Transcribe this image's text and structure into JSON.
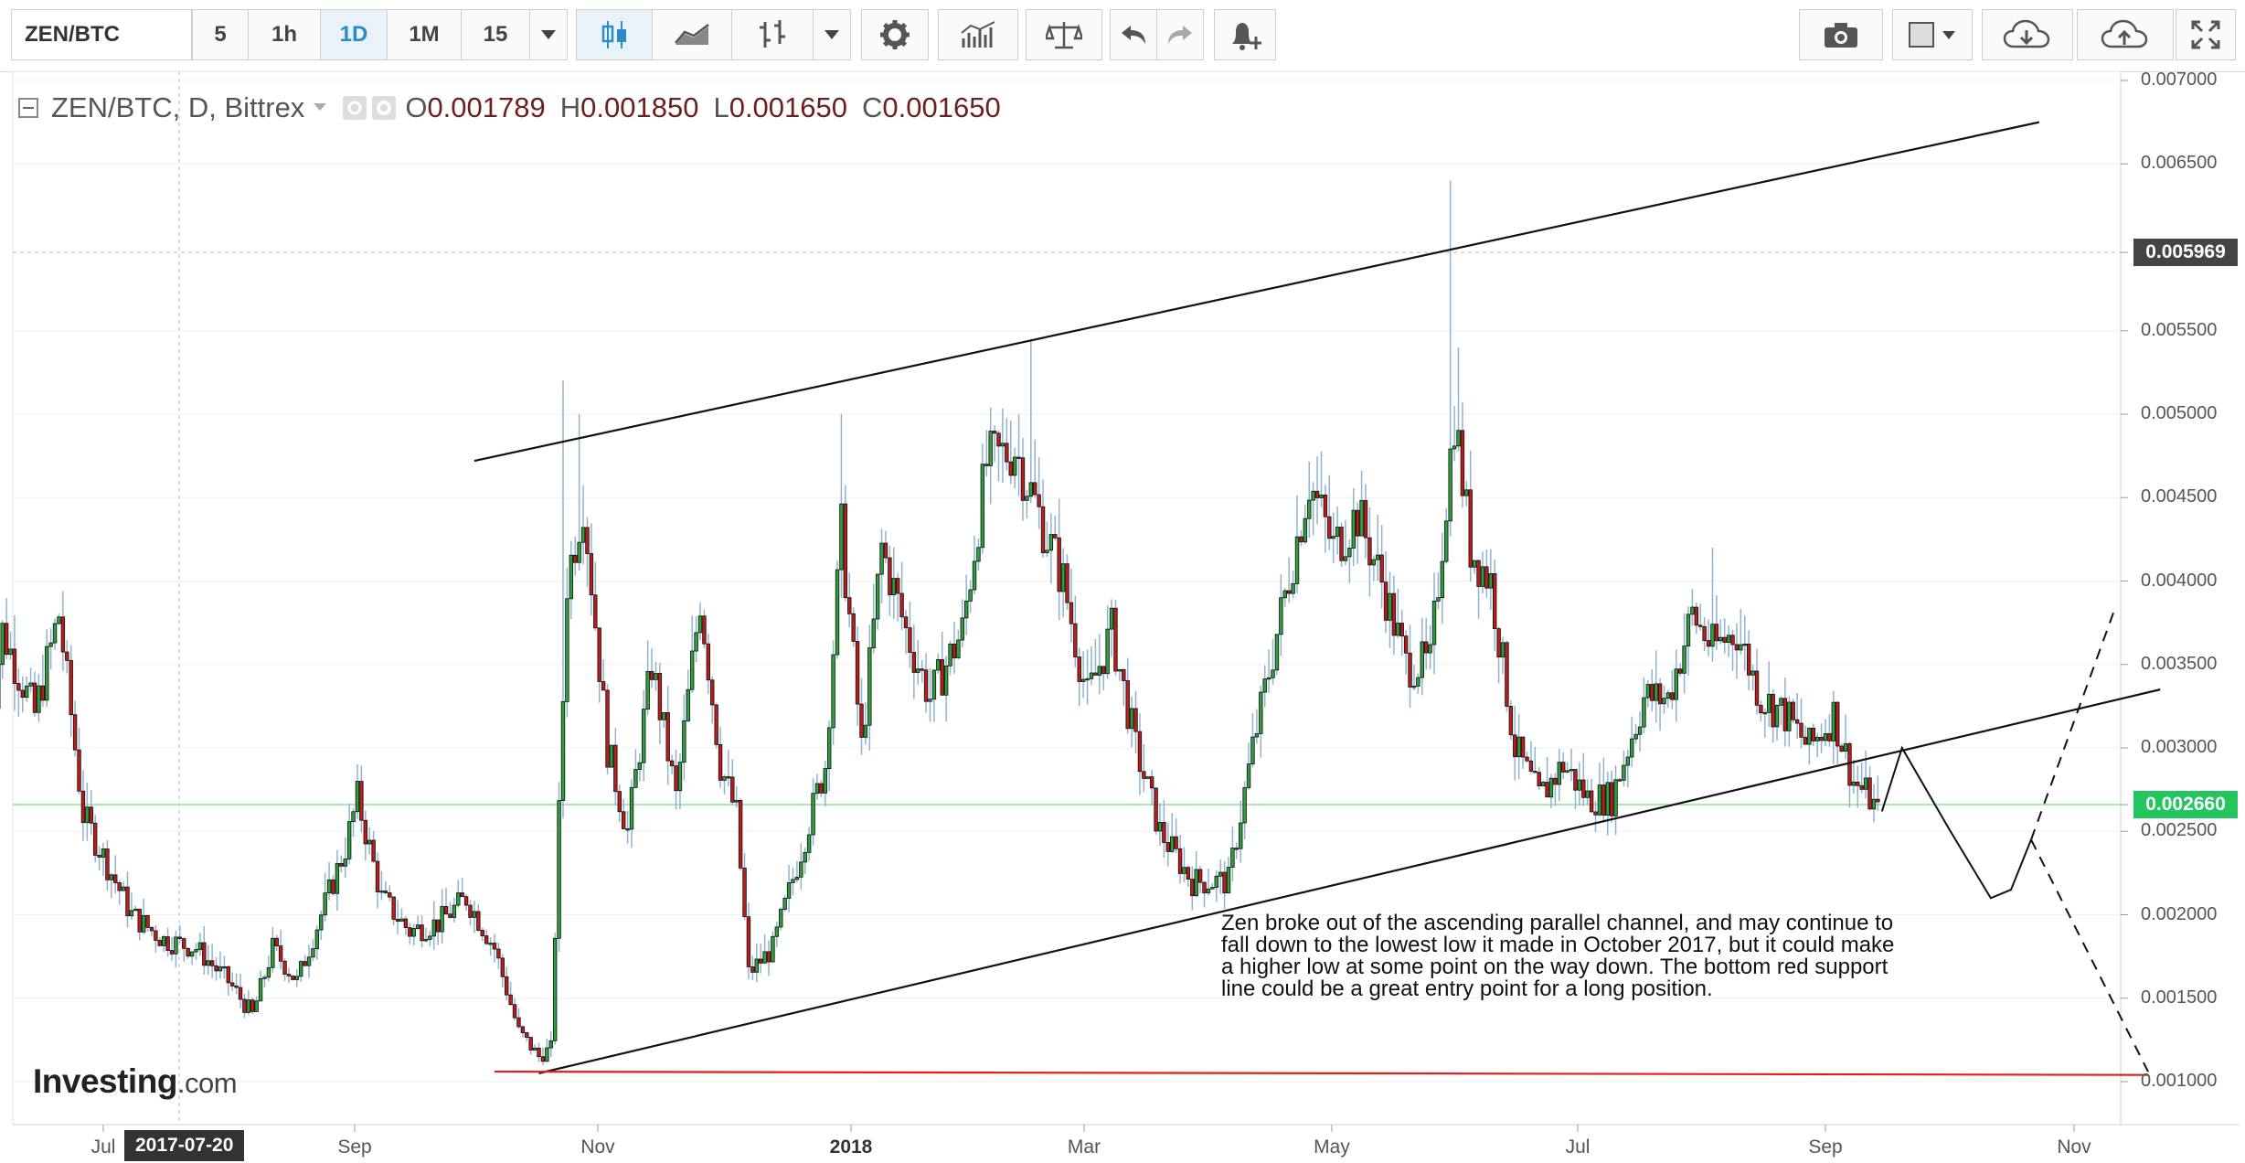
{
  "toolbar": {
    "symbol": "ZEN/BTC",
    "intervals": [
      "5",
      "1h",
      "1D",
      "1M",
      "15"
    ],
    "active_interval": "1D"
  },
  "legend": {
    "title": "ZEN/BTC, D, Bittrex",
    "open_label": "O",
    "open": "0.001789",
    "high_label": "H",
    "high": "0.001850",
    "low_label": "L",
    "low": "0.001650",
    "close_label": "C",
    "close": "0.001650"
  },
  "price_axis": {
    "ticks": [
      "0.007000",
      "0.006500",
      "0.005969",
      "0.005500",
      "0.005000",
      "0.004500",
      "0.004000",
      "0.003500",
      "0.003000",
      "0.002660",
      "0.002500",
      "0.002000",
      "0.001500",
      "0.001000"
    ],
    "current_price": "0.002660",
    "current_price_color": "#22c55e",
    "crosshair_price": "0.005969",
    "crosshair_color": "#444444"
  },
  "time_axis": {
    "labels": [
      "Jul",
      "2017-07-20",
      "Sep",
      "Nov",
      "2018",
      "Mar",
      "May",
      "Jul",
      "Sep",
      "Nov"
    ]
  },
  "annotation": "Zen broke out of the ascending parallel channel, and may continue to fall down to the lowest low it made in October 2017, but it could make a higher low at some point on the way down. The bottom red support line could be a great entry point for a long position.",
  "logo": {
    "brand": "Investing",
    "suffix": ".com"
  },
  "colors": {
    "up": "#2e9e3e",
    "down": "#b91d1d",
    "support": "#e11d1d",
    "channel": "#111111"
  },
  "chart_data": {
    "type": "candlestick",
    "title": "ZEN/BTC, D, Bittrex",
    "ylim": [
      0.00082,
      0.007
    ],
    "x_range": [
      "2017-06-01",
      "2018-11-20"
    ],
    "ohlc_last": {
      "open": 0.001789,
      "high": 0.00185,
      "low": 0.00165,
      "close": 0.00165
    },
    "close_path": [
      [
        "2017-06-02",
        0.003
      ],
      [
        "2017-06-06",
        0.0037
      ],
      [
        "2017-06-14",
        0.0032
      ],
      [
        "2017-06-20",
        0.0038
      ],
      [
        "2017-06-26",
        0.0026
      ],
      [
        "2017-07-02",
        0.0023
      ],
      [
        "2017-07-08",
        0.002
      ],
      [
        "2017-07-16",
        0.00185
      ],
      [
        "2017-07-24",
        0.0018
      ],
      [
        "2017-08-01",
        0.0016
      ],
      [
        "2017-08-07",
        0.0014
      ],
      [
        "2017-08-12",
        0.0018
      ],
      [
        "2017-08-18",
        0.0016
      ],
      [
        "2017-08-24",
        0.002
      ],
      [
        "2017-08-30",
        0.0024
      ],
      [
        "2017-09-02",
        0.0027
      ],
      [
        "2017-09-08",
        0.0021
      ],
      [
        "2017-09-15",
        0.0019
      ],
      [
        "2017-09-22",
        0.00195
      ],
      [
        "2017-09-29",
        0.0021
      ],
      [
        "2017-10-06",
        0.0018
      ],
      [
        "2017-10-12",
        0.0013
      ],
      [
        "2017-10-17",
        0.00115
      ],
      [
        "2017-10-20",
        0.0012
      ],
      [
        "2017-10-24",
        0.004
      ],
      [
        "2017-10-28",
        0.0045
      ],
      [
        "2017-11-03",
        0.003
      ],
      [
        "2017-11-08",
        0.0025
      ],
      [
        "2017-11-14",
        0.0035
      ],
      [
        "2017-11-20",
        0.0027
      ],
      [
        "2017-11-26",
        0.0039
      ],
      [
        "2017-12-01",
        0.0029
      ],
      [
        "2017-12-05",
        0.0026
      ],
      [
        "2017-12-08",
        0.00165
      ],
      [
        "2017-12-14",
        0.0018
      ],
      [
        "2017-12-20",
        0.0023
      ],
      [
        "2017-12-27",
        0.0029
      ],
      [
        "2017-12-31",
        0.0043
      ],
      [
        "2018-01-05",
        0.003
      ],
      [
        "2018-01-10",
        0.0042
      ],
      [
        "2018-01-16",
        0.0037
      ],
      [
        "2018-01-22",
        0.0033
      ],
      [
        "2018-01-30",
        0.0037
      ],
      [
        "2018-02-05",
        0.0047
      ],
      [
        "2018-02-12",
        0.0048
      ],
      [
        "2018-02-18",
        0.0044
      ],
      [
        "2018-02-24",
        0.004
      ],
      [
        "2018-03-02",
        0.0033
      ],
      [
        "2018-03-08",
        0.0037
      ],
      [
        "2018-03-14",
        0.003
      ],
      [
        "2018-03-20",
        0.0025
      ],
      [
        "2018-03-28",
        0.0022
      ],
      [
        "2018-04-06",
        0.0022
      ],
      [
        "2018-04-12",
        0.003
      ],
      [
        "2018-04-19",
        0.0038
      ],
      [
        "2018-04-26",
        0.0046
      ],
      [
        "2018-05-02",
        0.0042
      ],
      [
        "2018-05-08",
        0.0044
      ],
      [
        "2018-05-14",
        0.004
      ],
      [
        "2018-05-20",
        0.0035
      ],
      [
        "2018-05-26",
        0.0035
      ],
      [
        "2018-06-01",
        0.005
      ],
      [
        "2018-06-05",
        0.0042
      ],
      [
        "2018-06-10",
        0.004
      ],
      [
        "2018-06-16",
        0.003
      ],
      [
        "2018-06-22",
        0.0027
      ],
      [
        "2018-06-28",
        0.0029
      ],
      [
        "2018-07-04",
        0.0027
      ],
      [
        "2018-07-10",
        0.0027
      ],
      [
        "2018-07-18",
        0.0033
      ],
      [
        "2018-07-24",
        0.0033
      ],
      [
        "2018-07-30",
        0.0038
      ],
      [
        "2018-08-04",
        0.0036
      ],
      [
        "2018-08-10",
        0.0037
      ],
      [
        "2018-08-16",
        0.0033
      ],
      [
        "2018-08-22",
        0.0032
      ],
      [
        "2018-08-28",
        0.003
      ],
      [
        "2018-09-03",
        0.0032
      ],
      [
        "2018-09-08",
        0.0028
      ],
      [
        "2018-09-12",
        0.0027
      ],
      [
        "2018-09-14",
        0.0026
      ]
    ],
    "spikes": [
      [
        "2017-10-23",
        0.0052
      ],
      [
        "2017-10-27",
        0.005
      ],
      [
        "2017-12-31",
        0.005
      ],
      [
        "2018-02-16",
        0.00545
      ],
      [
        "2018-05-31",
        0.0064
      ],
      [
        "2018-06-02",
        0.0054
      ],
      [
        "2018-08-04",
        0.0042
      ]
    ],
    "overlays": {
      "channel_upper": [
        [
          "2017-10-01",
          0.00472
        ],
        [
          "2018-10-24",
          0.00675
        ]
      ],
      "channel_lower": [
        [
          "2017-10-17",
          0.00105
        ],
        [
          "2018-11-23",
          0.00335
        ]
      ],
      "support": [
        [
          "2017-10-06",
          0.00106
        ],
        [
          "2018-11-20",
          0.00104
        ]
      ],
      "projection_path": [
        [
          "2018-09-15",
          0.00262
        ],
        [
          "2018-09-20",
          0.003
        ],
        [
          "2018-10-02",
          0.0025
        ],
        [
          "2018-10-12",
          0.0021
        ],
        [
          "2018-10-17",
          0.00215
        ],
        [
          "2018-10-22",
          0.00245
        ]
      ],
      "projection_up": [
        [
          "2018-10-22",
          0.00245
        ],
        [
          "2018-11-12",
          0.00385
        ]
      ],
      "projection_down": [
        [
          "2018-10-22",
          0.00245
        ],
        [
          "2018-11-20",
          0.00106
        ]
      ]
    }
  }
}
